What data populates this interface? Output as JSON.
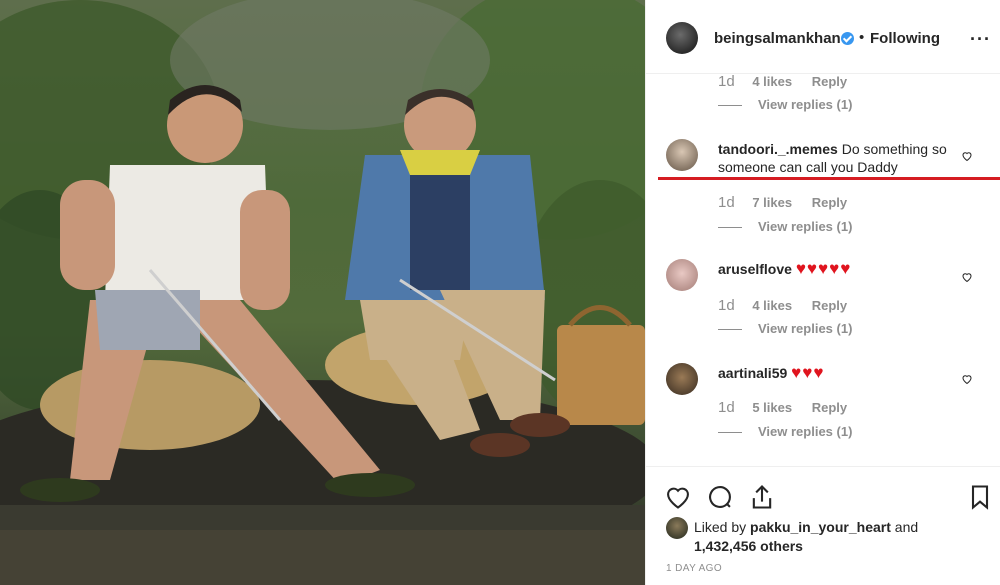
{
  "post": {
    "username": "beingsalmankhan",
    "separator": "•",
    "follow_label": "Following",
    "more_label": "···"
  },
  "comments": [
    {
      "partial": true,
      "age": "1d",
      "likes": "4 likes",
      "reply_label": "Reply",
      "view_replies": "View replies (1)"
    },
    {
      "username": "tandoori._.memes",
      "text": "Do something so someone can call you Daddy",
      "age": "1d",
      "likes": "7 likes",
      "reply_label": "Reply",
      "view_replies": "View replies (1)"
    },
    {
      "username": "aruselflove",
      "text": "♥♥♥♥♥",
      "age": "1d",
      "likes": "4 likes",
      "reply_label": "Reply",
      "view_replies": "View replies (1)"
    },
    {
      "username": "aartinali59",
      "text": "♥♥♥",
      "age": "1d",
      "likes": "5 likes",
      "reply_label": "Reply",
      "view_replies": "View replies (1)"
    }
  ],
  "footer": {
    "liked_prefix": "Liked by",
    "liked_user": "pakku_in_your_heart",
    "liked_and": "and",
    "likes_count": "1,432,456 others",
    "time_ago": "1 DAY AGO"
  },
  "colors": {
    "annotation_line": "#d51c22",
    "heart_emoji": "#e0141e",
    "verified_badge": "#3897f0",
    "muted_text": "#8e8e8e"
  },
  "icons": [
    "heart-icon",
    "comment-icon",
    "share-icon",
    "bookmark-icon",
    "verified-badge-icon",
    "small-heart-icon"
  ]
}
